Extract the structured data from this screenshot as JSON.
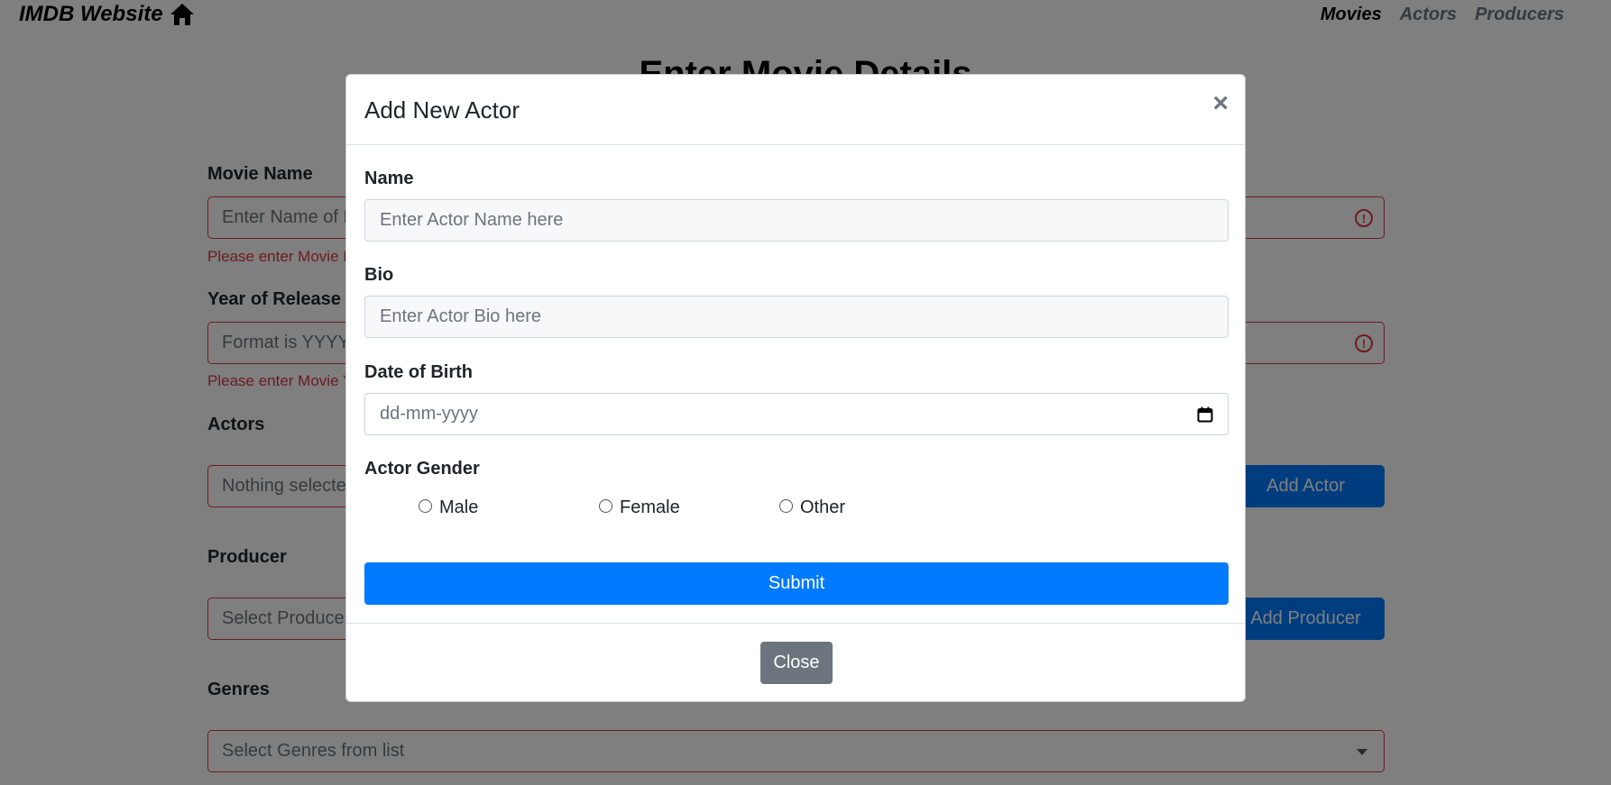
{
  "navbar": {
    "brand": "IMDB Website",
    "brand_icon": "home-icon",
    "links": [
      "Movies",
      "Actors",
      "Producers"
    ],
    "active_link": "Movies"
  },
  "page": {
    "heading": "Enter Movie Details",
    "movie_name": {
      "label": "Movie Name",
      "placeholder": "Enter Name of Movie here",
      "error": "Please enter Movie Name"
    },
    "year": {
      "label": "Year of Release",
      "placeholder": "Format is YYYY",
      "error": "Please enter Movie Year"
    },
    "actors": {
      "label": "Actors",
      "placeholder": "Nothing selected",
      "add_button": "Add Actor"
    },
    "producer": {
      "label": "Producer",
      "placeholder": "Select Producer",
      "add_button": "Add Producer"
    },
    "genres": {
      "label": "Genres",
      "placeholder": "Select Genres from list"
    }
  },
  "modal": {
    "title": "Add New Actor",
    "close_symbol": "×",
    "name": {
      "label": "Name",
      "placeholder": "Enter Actor Name here"
    },
    "bio": {
      "label": "Bio",
      "placeholder": "Enter Actor Bio here"
    },
    "dob": {
      "label": "Date of Birth",
      "placeholder": "dd-mm-yyyy"
    },
    "gender": {
      "label": "Actor Gender",
      "options": [
        "Male",
        "Female",
        "Other"
      ]
    },
    "submit_label": "Submit",
    "close_label": "Close"
  },
  "colors": {
    "primary": "#007bff",
    "secondary": "#6c757d",
    "danger": "#dc3545"
  }
}
